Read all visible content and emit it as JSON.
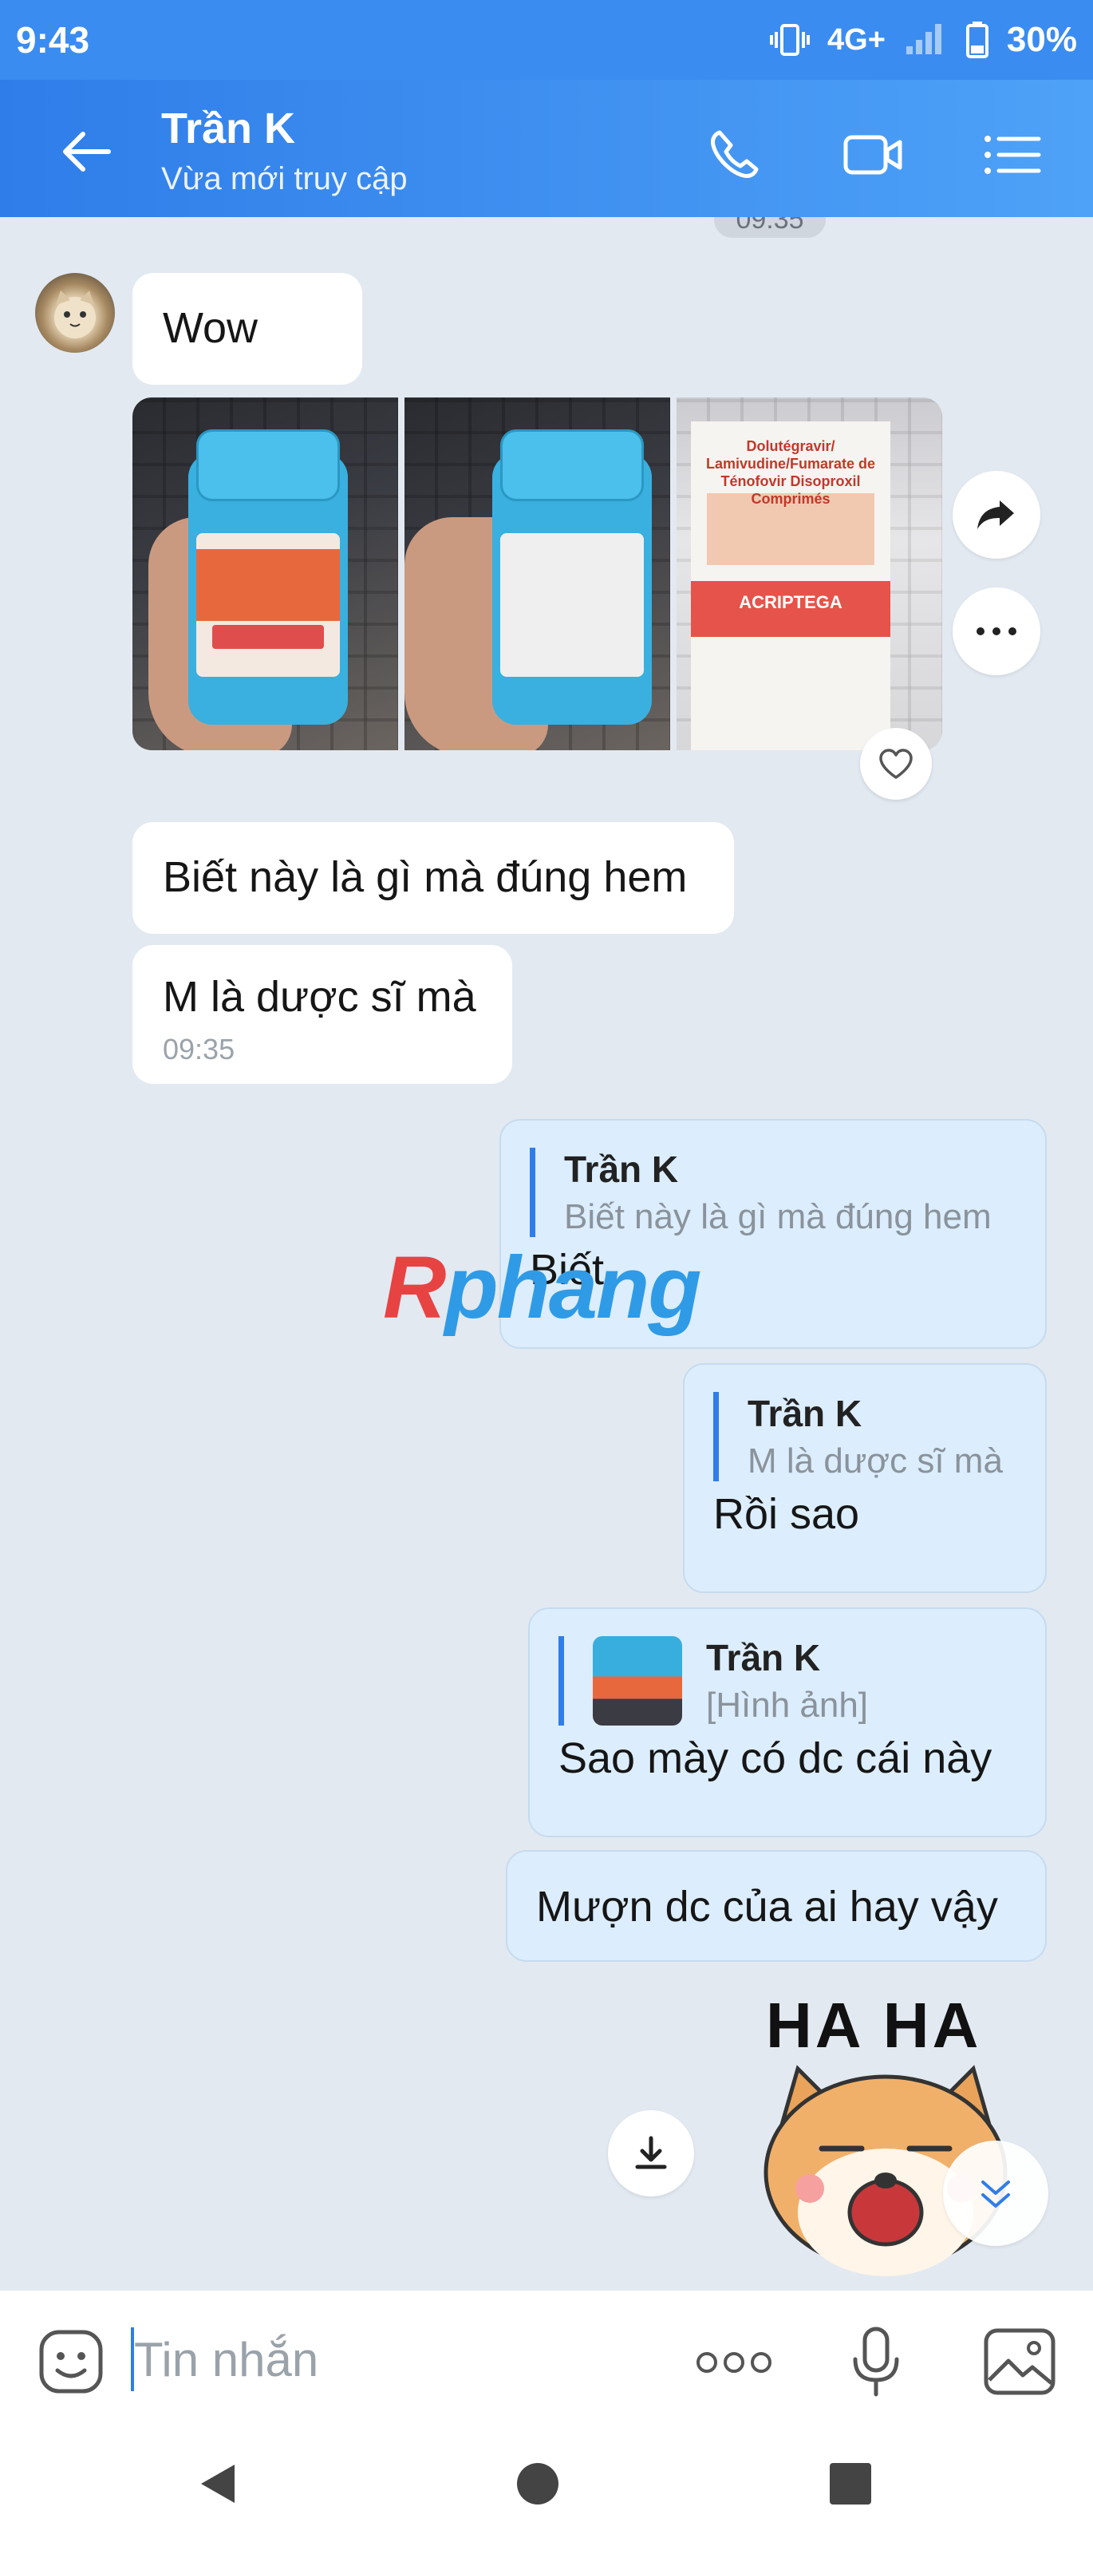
{
  "status_bar": {
    "time": "9:43",
    "network": "4G+",
    "battery": "30%"
  },
  "header": {
    "contact_name": "Trần K",
    "status": "Vừa mới truy cập"
  },
  "chat": {
    "time_chip": "09:35",
    "watermark": {
      "part1": "R",
      "part2": "phang"
    },
    "incoming": [
      {
        "text": "Wow"
      },
      {
        "text": "Biết này là gì mà đúng hem"
      },
      {
        "text": "M là dược sĩ mà",
        "time": "09:35"
      }
    ],
    "photos": {
      "photo3_text": "Dolutégravir/ Lamivudine/Fumarate de Ténofovir Disoproxil Comprimés",
      "photo3_brand": "ACRIPTEGA"
    },
    "outgoing": [
      {
        "quote_name": "Trần K",
        "quote_text": "Biết này là gì mà đúng hem",
        "text": "Biết"
      },
      {
        "quote_name": "Trần K",
        "quote_text": "M là dược sĩ mà",
        "text": "Rồi sao"
      },
      {
        "quote_name": "Trần K",
        "quote_text": "[Hình ảnh]",
        "text": "Sao mày có dc cái này"
      },
      {
        "text": "Mượn dc của ai hay vậy"
      }
    ],
    "sticker_text": "HA HA"
  },
  "input": {
    "placeholder": "Tin nhắn"
  }
}
